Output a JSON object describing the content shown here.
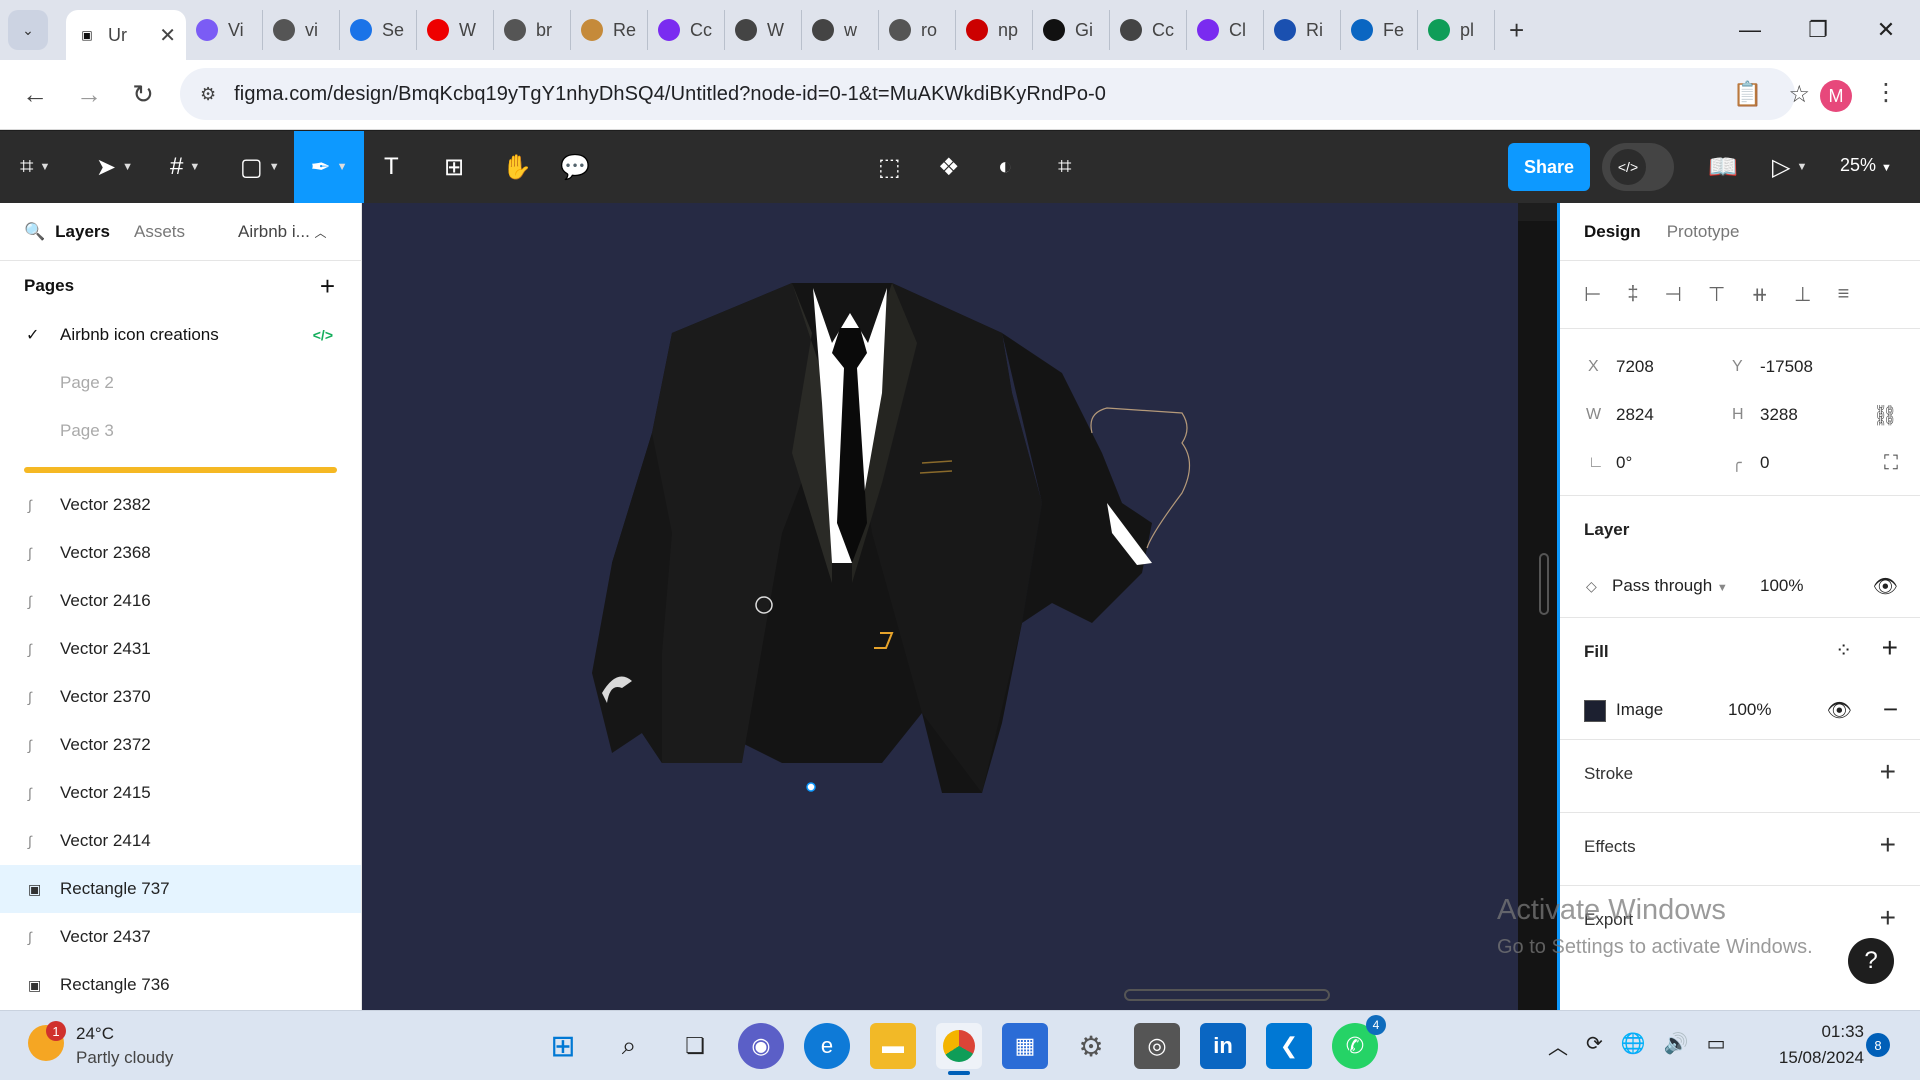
{
  "browser": {
    "active_tab_title": "Ur",
    "tabs": [
      {
        "label": "Vi",
        "color": "#7b5cf5"
      },
      {
        "label": "vi",
        "color": "#555"
      },
      {
        "label": "Se",
        "color": "#1a73e8"
      },
      {
        "label": "W",
        "color": "#e00"
      },
      {
        "label": "br",
        "color": "#555"
      },
      {
        "label": "Re",
        "color": "#c58a3a"
      },
      {
        "label": "Cc",
        "color": "#7a2bf0"
      },
      {
        "label": "W",
        "color": "#444"
      },
      {
        "label": "w",
        "color": "#444"
      },
      {
        "label": "ro",
        "color": "#555"
      },
      {
        "label": "np",
        "color": "#c00"
      },
      {
        "label": "Gi",
        "color": "#111"
      },
      {
        "label": "Cc",
        "color": "#444"
      },
      {
        "label": "Cl",
        "color": "#7a2bf0"
      },
      {
        "label": "Ri",
        "color": "#1a50b0"
      },
      {
        "label": "Fe",
        "color": "#0a66c2"
      },
      {
        "label": "pl",
        "color": "#0f9d58"
      }
    ],
    "url": "figma.com/design/BmqKcbq19yTgY1nhyDhSQ4/Untitled?node-id=0-1&t=MuAKWkdiBKyRndPo-0",
    "profile_initial": "M"
  },
  "figma": {
    "share_label": "Share",
    "zoom": "25%",
    "left_tabs": {
      "layers": "Layers",
      "assets": "Assets",
      "file": "Airbnb i..."
    },
    "pages_heading": "Pages",
    "pages": [
      {
        "name": "Airbnb icon creations",
        "current": true
      },
      {
        "name": "Page 2",
        "current": false
      },
      {
        "name": "Page 3",
        "current": false
      }
    ],
    "layers": [
      {
        "name": "Vector 2382",
        "selected": false
      },
      {
        "name": "Vector 2368",
        "selected": false
      },
      {
        "name": "Vector 2416",
        "selected": false
      },
      {
        "name": "Vector 2431",
        "selected": false
      },
      {
        "name": "Vector 2370",
        "selected": false
      },
      {
        "name": "Vector 2372",
        "selected": false
      },
      {
        "name": "Vector 2415",
        "selected": false
      },
      {
        "name": "Vector 2414",
        "selected": false
      },
      {
        "name": "Rectangle 737",
        "selected": true
      },
      {
        "name": "Vector 2437",
        "selected": false
      },
      {
        "name": "Rectangle 736",
        "selected": false
      }
    ],
    "right_tabs": {
      "design": "Design",
      "prototype": "Prototype"
    },
    "props": {
      "x_label": "X",
      "x": "7208",
      "y_label": "Y",
      "y": "-17508",
      "w_label": "W",
      "w": "2824",
      "h_label": "H",
      "h": "3288",
      "rotation": "0°",
      "radius": "0"
    },
    "layer_section": {
      "title": "Layer",
      "blend": "Pass through",
      "opacity": "100%"
    },
    "fill_section": {
      "title": "Fill",
      "type": "Image",
      "opacity": "100%"
    },
    "stroke_title": "Stroke",
    "effects_title": "Effects",
    "export_title": "Export",
    "watermark_line1": "Activate Windows",
    "watermark_line2": "Go to Settings to activate Windows.",
    "help_label": "?"
  },
  "taskbar": {
    "temperature": "24°C",
    "condition": "Partly cloudy",
    "weather_badge": "1",
    "time": "01:33",
    "date": "15/08/2024",
    "notification_count": "8",
    "whatsapp_badge": "4"
  }
}
